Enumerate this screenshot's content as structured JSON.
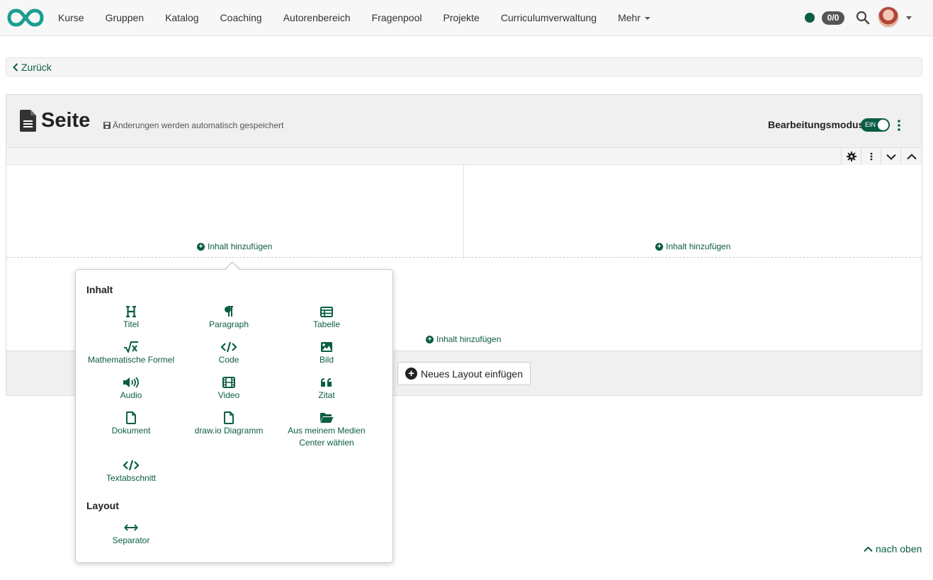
{
  "navbar": {
    "items": [
      {
        "label": "Kurse"
      },
      {
        "label": "Gruppen"
      },
      {
        "label": "Katalog"
      },
      {
        "label": "Coaching"
      },
      {
        "label": "Autorenbereich"
      },
      {
        "label": "Fragenpool"
      },
      {
        "label": "Projekte"
      },
      {
        "label": "Curriculumverwaltung"
      },
      {
        "label": "Mehr"
      }
    ],
    "count_badge": "0/0",
    "status_color": "#0b5d44"
  },
  "back": {
    "label": "Zurück"
  },
  "page": {
    "title": "Seite",
    "autosave": "Änderungen werden automatisch gespeichert",
    "edit_mode_label": "Bearbeitungsmodus",
    "toggle_text": "EIN"
  },
  "cells": {
    "add_content": "Inhalt hinzufügen"
  },
  "new_layout": "Neues Layout einfügen",
  "popover": {
    "section_content": "Inhalt",
    "section_layout": "Layout",
    "items": [
      {
        "label": "Titel",
        "icon": "heading-icon"
      },
      {
        "label": "Paragraph",
        "icon": "paragraph-icon"
      },
      {
        "label": "Tabelle",
        "icon": "table-icon"
      },
      {
        "label": "Mathematische Formel",
        "icon": "math-formula-icon"
      },
      {
        "label": "Code",
        "icon": "code-icon"
      },
      {
        "label": "Bild",
        "icon": "image-icon"
      },
      {
        "label": "Audio",
        "icon": "audio-icon"
      },
      {
        "label": "Video",
        "icon": "video-icon"
      },
      {
        "label": "Zitat",
        "icon": "quote-icon"
      },
      {
        "label": "Dokument",
        "icon": "document-icon"
      },
      {
        "label": "draw.io Diagramm",
        "icon": "drawio-icon"
      },
      {
        "label": "Aus meinem Medien Center wählen",
        "icon": "folder-open-icon"
      },
      {
        "label": "Textabschnitt",
        "icon": "code-icon"
      }
    ],
    "layout_items": [
      {
        "label": "Separator",
        "icon": "separator-icon"
      }
    ]
  },
  "back_to_top": "nach oben",
  "colors": {
    "accent": "#0b5d44"
  }
}
